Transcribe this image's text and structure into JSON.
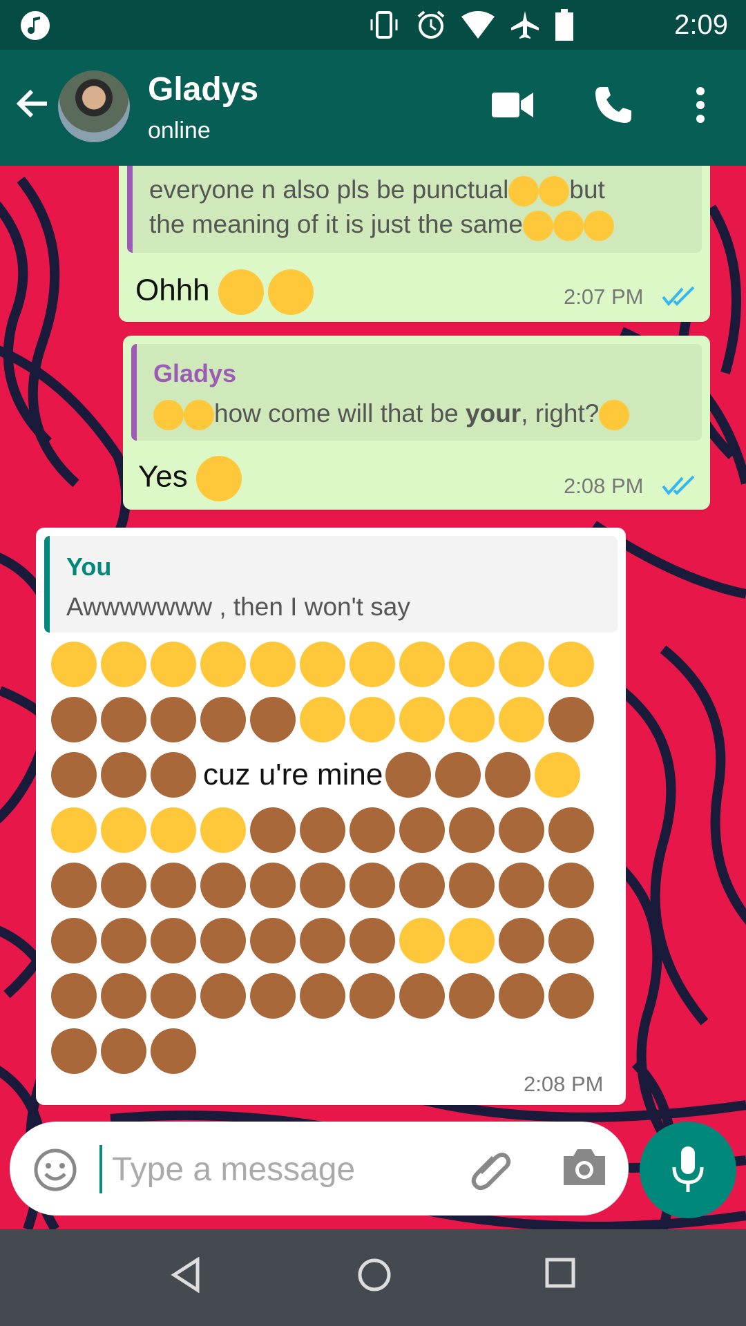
{
  "status_bar": {
    "time": "2:09",
    "icons": [
      "music-note-icon",
      "vibrate-icon",
      "alarm-icon",
      "wifi-icon",
      "airplane-icon",
      "battery-icon"
    ]
  },
  "header": {
    "contact_name": "Gladys",
    "contact_status": "online",
    "icons": [
      "back-arrow-icon",
      "video-call-icon",
      "phone-call-icon",
      "more-vert-icon"
    ]
  },
  "messages": [
    {
      "direction": "outgoing",
      "quote_lines": [
        "everyone n also pls be punctual",
        "the meaning of it is just the same"
      ],
      "quote_line1_suffix": "but",
      "text": "Ohhh",
      "time": "2:07 PM",
      "status": "read"
    },
    {
      "direction": "outgoing",
      "quote_author": "Gladys",
      "quote_text_before": "how come will that be ",
      "quote_text_bold": "your",
      "quote_text_after": ", right?",
      "text": "Yes",
      "time": "2:08 PM",
      "status": "read"
    },
    {
      "direction": "incoming",
      "quote_author": "You",
      "quote_text": "Awwwwwww , then I won't say",
      "inline_text": "cuz u're mine",
      "time": "2:08 PM",
      "emoji_rows": [
        [
          "hand-over-mouth",
          "hand-over-mouth",
          "hand-over-mouth",
          "hand-over-mouth",
          "hand-over-mouth",
          "hand-over-mouth",
          "hand-over-mouth",
          "hand-over-mouth",
          "hand-over-mouth",
          "hand-over-mouth",
          "hand-over-mouth"
        ],
        [
          "see-no-evil-monkey",
          "see-no-evil-monkey",
          "see-no-evil-monkey",
          "see-no-evil-monkey",
          "see-no-evil-monkey",
          "upside-down-face",
          "upside-down-face",
          "hand-over-mouth",
          "hand-over-mouth",
          "hand-over-mouth",
          "see-no-evil-monkey"
        ],
        [
          "see-no-evil-monkey",
          "see-no-evil-monkey",
          "see-no-evil-monkey",
          "TEXT",
          "see-no-evil-monkey",
          "see-no-evil-monkey",
          "see-no-evil-monkey",
          "flushed-face"
        ],
        [
          "flushed-face",
          "flushed-face",
          "flushed-face",
          "flushed-face",
          "see-no-evil-monkey",
          "see-no-evil-monkey",
          "see-no-evil-monkey",
          "see-no-evil-monkey",
          "see-no-evil-monkey",
          "see-no-evil-monkey",
          "see-no-evil-monkey"
        ],
        [
          "see-no-evil-monkey",
          "see-no-evil-monkey",
          "see-no-evil-monkey",
          "see-no-evil-monkey",
          "see-no-evil-monkey",
          "see-no-evil-monkey",
          "see-no-evil-monkey",
          "see-no-evil-monkey",
          "see-no-evil-monkey",
          "see-no-evil-monkey",
          "see-no-evil-monkey"
        ],
        [
          "see-no-evil-monkey",
          "see-no-evil-monkey",
          "see-no-evil-monkey",
          "see-no-evil-monkey",
          "see-no-evil-monkey",
          "see-no-evil-monkey",
          "see-no-evil-monkey",
          "hand-over-mouth",
          "hand-over-mouth",
          "see-no-evil-monkey",
          "see-no-evil-monkey"
        ],
        [
          "see-no-evil-monkey",
          "see-no-evil-monkey",
          "see-no-evil-monkey",
          "see-no-evil-monkey",
          "see-no-evil-monkey",
          "see-no-evil-monkey",
          "see-no-evil-monkey",
          "see-no-evil-monkey",
          "see-no-evil-monkey",
          "see-no-evil-monkey",
          "see-no-evil-monkey"
        ],
        [
          "see-no-evil-monkey",
          "see-no-evil-monkey",
          "see-no-evil-monkey"
        ]
      ]
    }
  ],
  "composer": {
    "placeholder": "Type a message",
    "icons": [
      "emoji-icon",
      "attach-icon",
      "camera-icon",
      "mic-icon"
    ]
  },
  "nav_bar": {
    "icons": [
      "nav-back-icon",
      "nav-home-icon",
      "nav-recents-icon"
    ]
  },
  "colors": {
    "header": "#075e54",
    "status_bar": "#054d44",
    "outgoing_bubble": "#dcf8c6",
    "incoming_bubble": "#ffffff",
    "accent": "#00897b",
    "read_ticks": "#34b7f1",
    "wallpaper_red": "#e8174a",
    "wallpaper_stripes": "#1a1a3a",
    "quote_author_gladys": "#9c5bb5",
    "quote_author_you": "#00897b"
  }
}
